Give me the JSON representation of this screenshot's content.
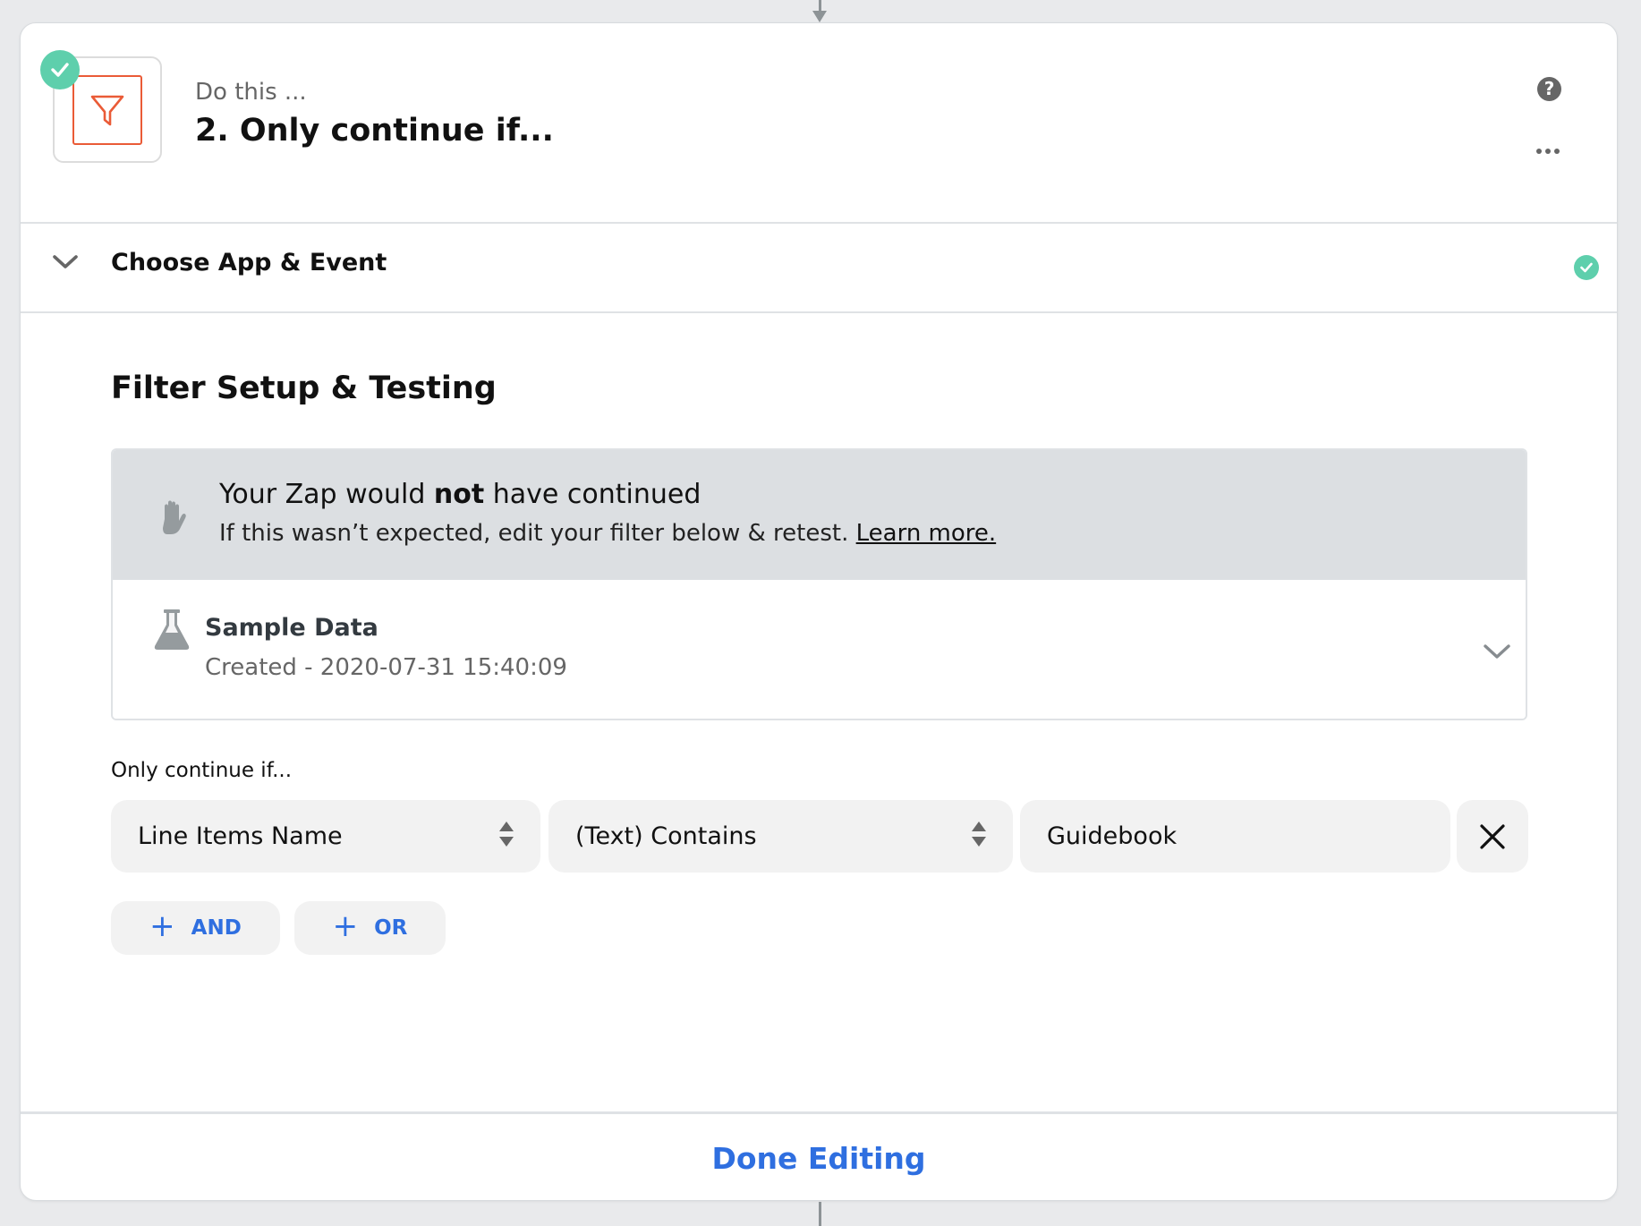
{
  "header": {
    "eyebrow": "Do this ...",
    "title": "2. Only continue if...",
    "app_icon": "filter-funnel-icon",
    "status": "complete",
    "help_icon_glyph": "?",
    "more_icon": "more-horizontal-icon"
  },
  "sections": {
    "choose_app": {
      "label": "Choose App & Event",
      "status": "complete"
    },
    "filter": {
      "title": "Filter Setup & Testing"
    }
  },
  "alert": {
    "title_prefix": "Your Zap would ",
    "title_emphasis": "not",
    "title_suffix": " have continued",
    "message": "If this wasn’t expected, edit your filter below & retest. ",
    "link": "Learn more.",
    "icon": "hand-stop-icon"
  },
  "sample": {
    "title": "Sample Data",
    "subtitle": "Created - 2020-07-31 15:40:09",
    "icon": "flask-icon"
  },
  "rule": {
    "label": "Only continue if...",
    "field": "Line Items Name",
    "operator": "(Text) Contains",
    "value": "Guidebook"
  },
  "buttons": {
    "and": "AND",
    "or": "OR",
    "plus_glyph": "+",
    "done": "Done Editing"
  },
  "colors": {
    "accent_blue": "#2f6fe0",
    "success_green": "#5ecfac",
    "filter_orange": "#ea5b37",
    "alert_bg": "#dcdfe2"
  }
}
